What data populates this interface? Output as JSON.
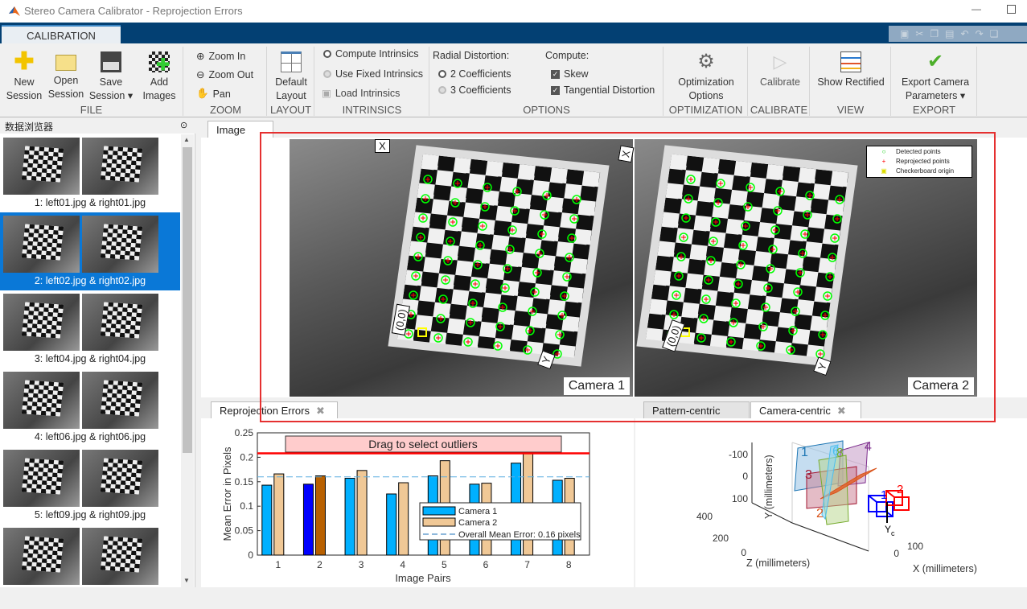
{
  "window": {
    "title": "Stereo Camera Calibrator - Reprojection Errors"
  },
  "ribbon": {
    "tab": "CALIBRATION",
    "file": {
      "label": "FILE",
      "new": "New\nSession",
      "open": "Open\nSession",
      "save": "Save\nSession ▾",
      "add": "Add\nImages"
    },
    "zoom": {
      "label": "ZOOM",
      "zoom_in": "Zoom In",
      "zoom_out": "Zoom Out",
      "pan": "Pan"
    },
    "layout": {
      "label": "LAYOUT",
      "default": "Default\nLayout"
    },
    "intrinsics": {
      "label": "INTRINSICS",
      "compute": "Compute Intrinsics",
      "fixed": "Use Fixed Intrinsics",
      "load": "Load Intrinsics"
    },
    "options": {
      "label": "OPTIONS",
      "radial": "Radial Distortion:",
      "two": "2 Coefficients",
      "three": "3 Coefficients",
      "compute": "Compute:",
      "skew": "Skew",
      "tangential": "Tangential Distortion"
    },
    "optimization": {
      "label": "OPTIMIZATION",
      "button": "Optimization\nOptions"
    },
    "calibrate": {
      "label": "CALIBRATE",
      "button": "Calibrate"
    },
    "view": {
      "label": "VIEW",
      "button": "Show Rectified"
    },
    "export": {
      "label": "EXPORT",
      "button": "Export Camera\nParameters ▾"
    }
  },
  "browser": {
    "title": "数据浏览器",
    "items": [
      {
        "label": "1: left01.jpg & right01.jpg"
      },
      {
        "label": "2: left02.jpg & right02.jpg",
        "selected": true
      },
      {
        "label": "3: left04.jpg & right04.jpg"
      },
      {
        "label": "4: left06.jpg & right06.jpg"
      },
      {
        "label": "5: left09.jpg & right09.jpg"
      },
      {
        "label": ""
      }
    ]
  },
  "image_tab": {
    "label": "Image",
    "cam1": "Camera 1",
    "cam2": "Camera 2",
    "x_label": "X",
    "origin_label": "(0,0)",
    "y_label": "Y",
    "legend": {
      "detected": "Detected points",
      "reprojected": "Reprojected points",
      "origin": "Checkerboard origin"
    },
    "colors": {
      "detected": "#00ff00",
      "reprojected": "#ff0000",
      "origin": "#ffff00"
    }
  },
  "reproj_tab": {
    "label": "Reprojection Errors"
  },
  "right_tabs": {
    "pattern": "Pattern-centric",
    "camera": "Camera-centric",
    "active": "Camera-centric"
  },
  "chart_data": [
    {
      "type": "bar",
      "categories": [
        "1",
        "2",
        "3",
        "4",
        "5",
        "6",
        "7",
        "8"
      ],
      "series": [
        {
          "name": "Camera 1",
          "values": [
            0.143,
            0.145,
            0.157,
            0.125,
            0.162,
            0.145,
            0.188,
            0.153
          ],
          "color": "#00b0ff",
          "selected_color": "#0000ff"
        },
        {
          "name": "Camera 2",
          "values": [
            0.166,
            0.162,
            0.173,
            0.148,
            0.193,
            0.147,
            0.21,
            0.157
          ],
          "color": "#f0c896",
          "selected_color": "#b86000"
        }
      ],
      "selected_category": "2",
      "mean_line": {
        "value": 0.16,
        "label": "Overall Mean Error: 0.16 pixels"
      },
      "threshold": 0.208,
      "drag_label": "Drag to select outliers",
      "xlabel": "Image Pairs",
      "ylabel": "Mean Error in Pixels",
      "ylim": [
        0,
        0.25
      ],
      "yticks": [
        "0",
        "0.05",
        "0.1",
        "0.15",
        "0.2",
        "0.25"
      ],
      "legend": "bottom-right"
    },
    {
      "type": "3d-extrinsics",
      "xlabel": "X (millimeters)",
      "ylabel": "Y (millimeters)",
      "zlabel": "Z (millimeters)",
      "xticks": [
        "0",
        "100"
      ],
      "yticks": [
        "-100",
        "0",
        "100"
      ],
      "zticks": [
        "0",
        "200",
        "400"
      ],
      "pattern_labels": [
        "1",
        "2",
        "3",
        "4",
        "5",
        "6",
        "7",
        "8"
      ],
      "camera_labels": [
        "1",
        "2"
      ],
      "axis_label": "Y",
      "axis_sub": "c"
    }
  ]
}
